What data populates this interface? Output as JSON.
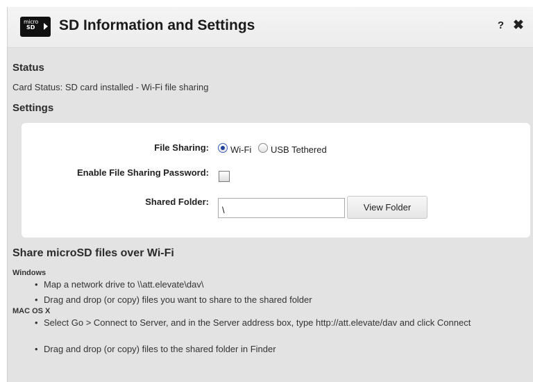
{
  "dialog": {
    "icon": {
      "micro_text": "micro",
      "sd_text": "SD"
    },
    "title": "SD Information and Settings",
    "help_label": "?",
    "close_label": "✖"
  },
  "status": {
    "heading": "Status",
    "card_status": "Card Status: SD card installed - Wi-Fi file sharing"
  },
  "settings": {
    "heading": "Settings",
    "file_sharing": {
      "label": "File Sharing:",
      "options": [
        "Wi-Fi",
        "USB Tethered"
      ],
      "selected": "Wi-Fi"
    },
    "password": {
      "label": "Enable File Sharing Password:",
      "checked": false
    },
    "shared_folder": {
      "label": "Shared Folder:",
      "value": "\\",
      "button_label": "View Folder"
    }
  },
  "share": {
    "heading": "Share microSD files over Wi-Fi",
    "windows": {
      "heading": "Windows",
      "items": [
        "Map a network drive to \\\\att.elevate\\dav\\",
        "Drag and drop (or copy) files you want to share to the shared folder"
      ]
    },
    "mac": {
      "heading": "MAC OS X",
      "items": [
        "Select Go > Connect to Server, and in the Server address box, type http://att.elevate/dav and click Connect",
        "Drag and drop (or copy) files to the shared folder in Finder"
      ]
    }
  },
  "bullet_glyph": "•"
}
